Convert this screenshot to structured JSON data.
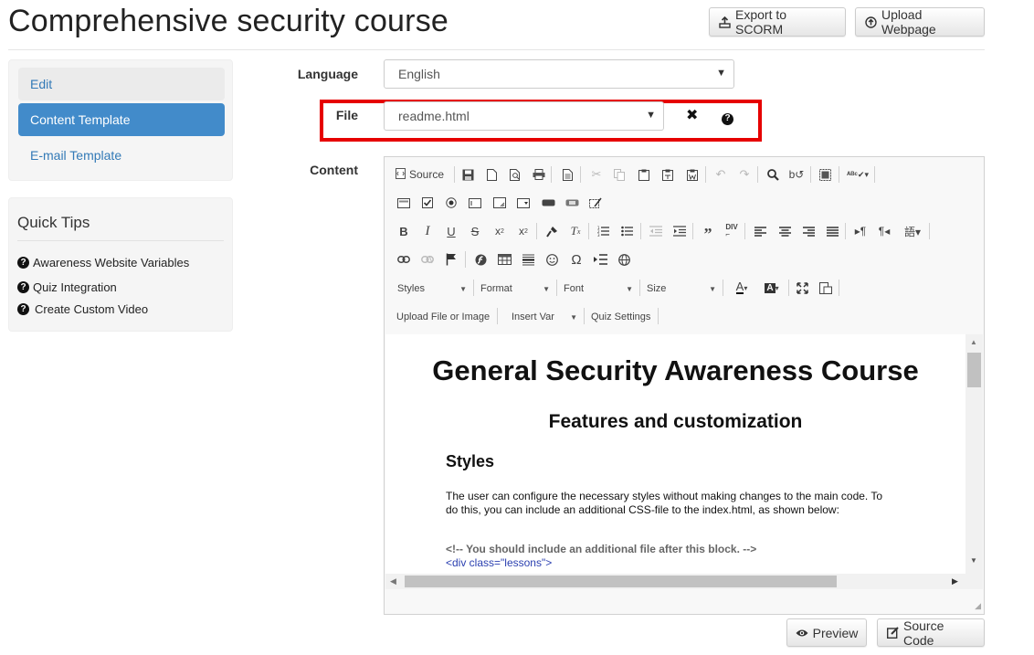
{
  "page": {
    "title": "Comprehensive security course"
  },
  "header_buttons": {
    "export": "Export to SCORM",
    "upload": "Upload Webpage"
  },
  "sidebar": {
    "items": [
      {
        "label": "Edit"
      },
      {
        "label": "Content Template"
      },
      {
        "label": "E-mail Template"
      }
    ]
  },
  "tips": {
    "title": "Quick Tips",
    "items": [
      {
        "label": "Awareness Website Variables"
      },
      {
        "label": "Quiz Integration"
      },
      {
        "label": "Create Custom Video"
      }
    ]
  },
  "form": {
    "language_label": "Language",
    "language_value": "English",
    "file_label": "File",
    "file_value": "readme.html",
    "content_label": "Content"
  },
  "editor": {
    "source_label": "Source",
    "combos": {
      "styles": "Styles",
      "format": "Format",
      "font": "Font",
      "size": "Size"
    },
    "row6": {
      "upload": "Upload File or Image",
      "insert_var": "Insert Var",
      "quiz_settings": "Quiz Settings"
    },
    "doc": {
      "h1": "General Security Awareness Course",
      "h2": "Features and customization",
      "h3": "Styles",
      "p": "The user can configure the necessary styles without making changes to the main code. To do this, you can include an additional CSS-file to the index.html, as shown below:",
      "code_comment": "<!-- You should include an additional file after this block. -->",
      "code_div": "<div class=\"lessons\">",
      "code_more": "..."
    }
  },
  "footer_buttons": {
    "preview": "Preview",
    "source_code": "Source Code"
  },
  "colors": {
    "accent": "#428bca",
    "link": "#337ab7",
    "highlight": "#e60000"
  }
}
